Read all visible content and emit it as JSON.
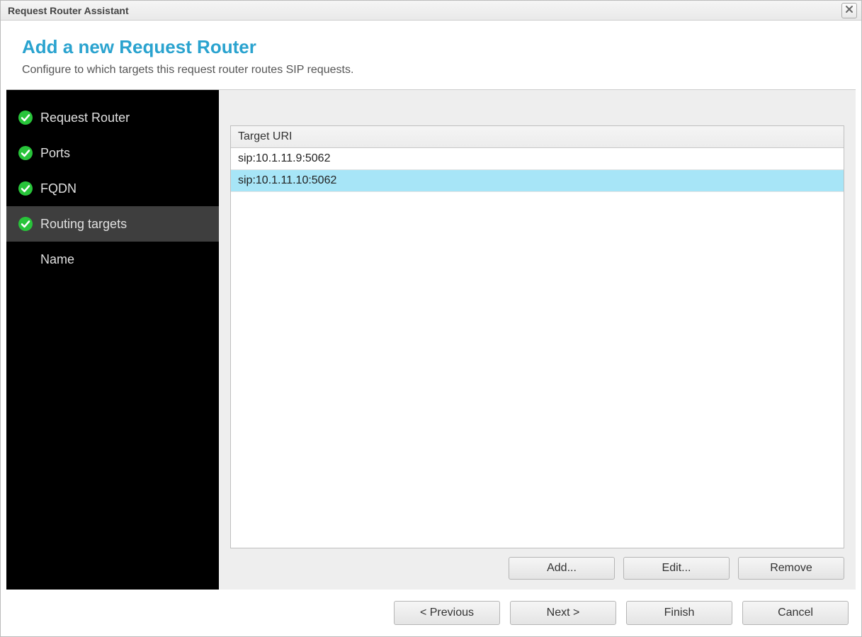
{
  "window": {
    "title": "Request Router Assistant"
  },
  "header": {
    "heading": "Add a new Request Router",
    "subheading": "Configure to which targets this request router routes SIP requests."
  },
  "sidebar": {
    "items": [
      {
        "label": "Request Router",
        "complete": true,
        "selected": false
      },
      {
        "label": "Ports",
        "complete": true,
        "selected": false
      },
      {
        "label": "FQDN",
        "complete": true,
        "selected": false
      },
      {
        "label": "Routing targets",
        "complete": true,
        "selected": true
      },
      {
        "label": "Name",
        "complete": false,
        "selected": false
      }
    ]
  },
  "main": {
    "table": {
      "header": "Target URI",
      "rows": [
        {
          "uri": "sip:10.1.11.9:5062",
          "selected": false
        },
        {
          "uri": "sip:10.1.11.10:5062",
          "selected": true
        }
      ]
    },
    "buttons": {
      "add": "Add...",
      "edit": "Edit...",
      "remove": "Remove"
    }
  },
  "footer": {
    "previous": "< Previous",
    "next": "Next >",
    "finish": "Finish",
    "cancel": "Cancel"
  }
}
